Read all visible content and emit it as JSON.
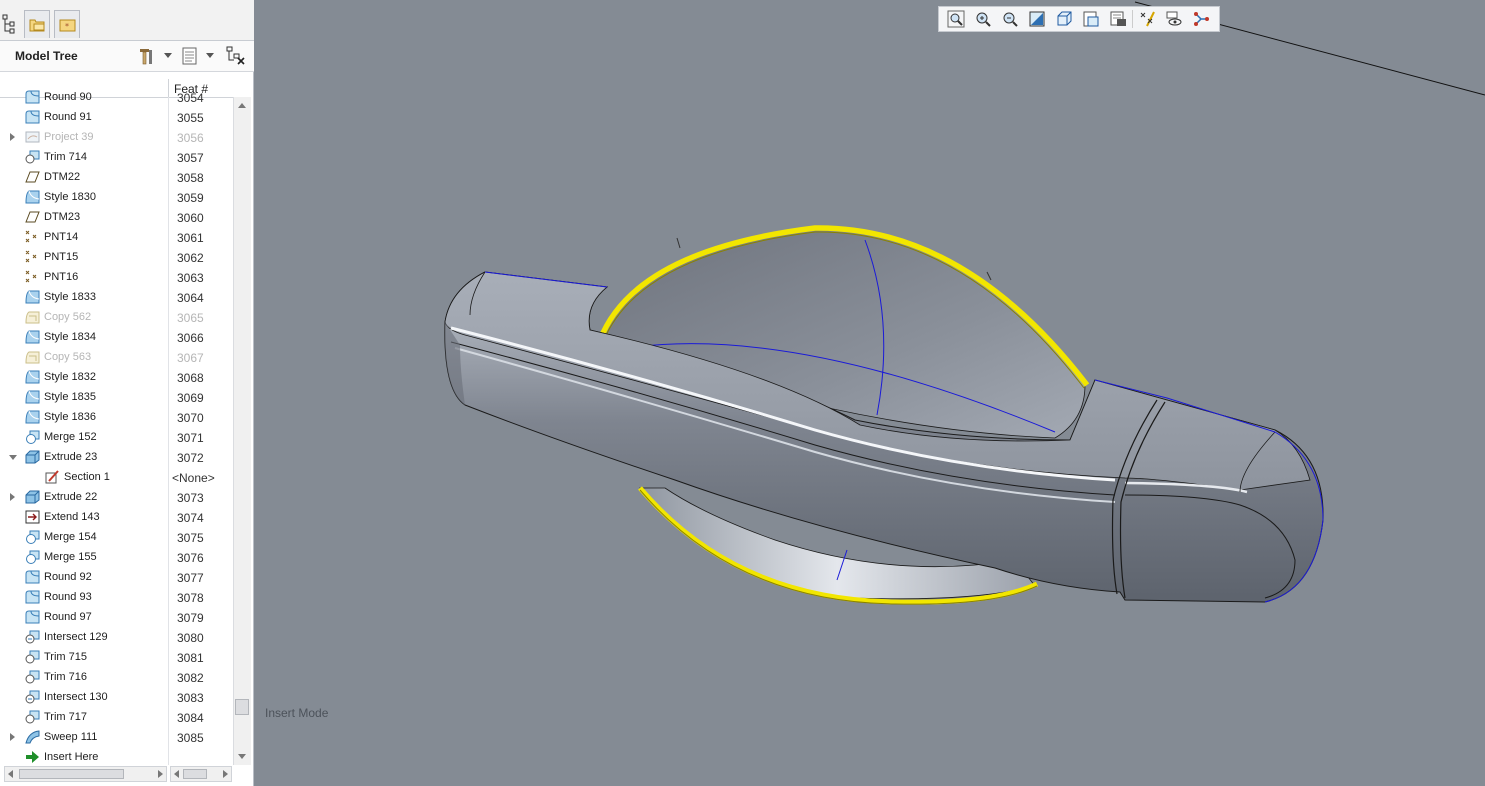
{
  "panel": {
    "title": "Model Tree",
    "column_header": "Feat #",
    "tabs": [
      "model-tree-tab",
      "folder-browser-tab",
      "favorites-tab"
    ]
  },
  "tree": [
    {
      "label": "Round 90",
      "num": "3054",
      "icon": "round-icon",
      "partial": true
    },
    {
      "label": "Round 91",
      "num": "3055",
      "icon": "round-icon"
    },
    {
      "label": "Project 39",
      "num": "3056",
      "icon": "project-icon",
      "dim": true,
      "expand": "right"
    },
    {
      "label": "Trim 714",
      "num": "3057",
      "icon": "trim-icon"
    },
    {
      "label": "DTM22",
      "num": "3058",
      "icon": "datum-plane-icon"
    },
    {
      "label": "Style 1830",
      "num": "3059",
      "icon": "style-icon"
    },
    {
      "label": "DTM23",
      "num": "3060",
      "icon": "datum-plane-icon"
    },
    {
      "label": "PNT14",
      "num": "3061",
      "icon": "datum-point-icon"
    },
    {
      "label": "PNT15",
      "num": "3062",
      "icon": "datum-point-icon"
    },
    {
      "label": "PNT16",
      "num": "3063",
      "icon": "datum-point-icon"
    },
    {
      "label": "Style 1833",
      "num": "3064",
      "icon": "style-icon"
    },
    {
      "label": "Copy 562",
      "num": "3065",
      "icon": "copy-icon",
      "dim": true
    },
    {
      "label": "Style 1834",
      "num": "3066",
      "icon": "style-icon"
    },
    {
      "label": "Copy 563",
      "num": "3067",
      "icon": "copy-icon",
      "dim": true
    },
    {
      "label": "Style 1832",
      "num": "3068",
      "icon": "style-icon"
    },
    {
      "label": "Style 1835",
      "num": "3069",
      "icon": "style-icon"
    },
    {
      "label": "Style 1836",
      "num": "3070",
      "icon": "style-icon"
    },
    {
      "label": "Merge 152",
      "num": "3071",
      "icon": "merge-icon"
    },
    {
      "label": "Extrude 23",
      "num": "3072",
      "icon": "extrude-icon",
      "expand": "down"
    },
    {
      "label": "Section 1",
      "num": "<None>",
      "icon": "sketch-icon",
      "child": true
    },
    {
      "label": "Extrude 22",
      "num": "3073",
      "icon": "extrude-icon",
      "expand": "right"
    },
    {
      "label": "Extend 143",
      "num": "3074",
      "icon": "extend-icon"
    },
    {
      "label": "Merge 154",
      "num": "3075",
      "icon": "merge-icon"
    },
    {
      "label": "Merge 155",
      "num": "3076",
      "icon": "merge-icon"
    },
    {
      "label": "Round 92",
      "num": "3077",
      "icon": "round-icon"
    },
    {
      "label": "Round 93",
      "num": "3078",
      "icon": "round-icon"
    },
    {
      "label": "Round 97",
      "num": "3079",
      "icon": "round-icon"
    },
    {
      "label": "Intersect 129",
      "num": "3080",
      "icon": "intersect-icon"
    },
    {
      "label": "Trim 715",
      "num": "3081",
      "icon": "trim-icon"
    },
    {
      "label": "Trim 716",
      "num": "3082",
      "icon": "trim-icon"
    },
    {
      "label": "Intersect 130",
      "num": "3083",
      "icon": "intersect-icon"
    },
    {
      "label": "Trim 717",
      "num": "3084",
      "icon": "trim-icon"
    },
    {
      "label": "Sweep 111",
      "num": "3085",
      "icon": "sweep-icon",
      "expand": "right"
    },
    {
      "label": "Insert Here",
      "num": "",
      "icon": "insert-here-arrow-icon"
    }
  ],
  "viewport": {
    "mode_text": "Insert Mode",
    "toolbar": [
      "refit-icon",
      "zoom-in-icon",
      "zoom-out-icon",
      "repaint-icon",
      "display-style-icon",
      "saved-orientations-icon",
      "view-manager-icon",
      "datum-display-icon",
      "spin-center-icon",
      "annotation-display-icon"
    ],
    "colors": {
      "background": "#848b94",
      "edge_highlight": "#f2e600",
      "datum_curve": "#1a1ad8"
    }
  }
}
